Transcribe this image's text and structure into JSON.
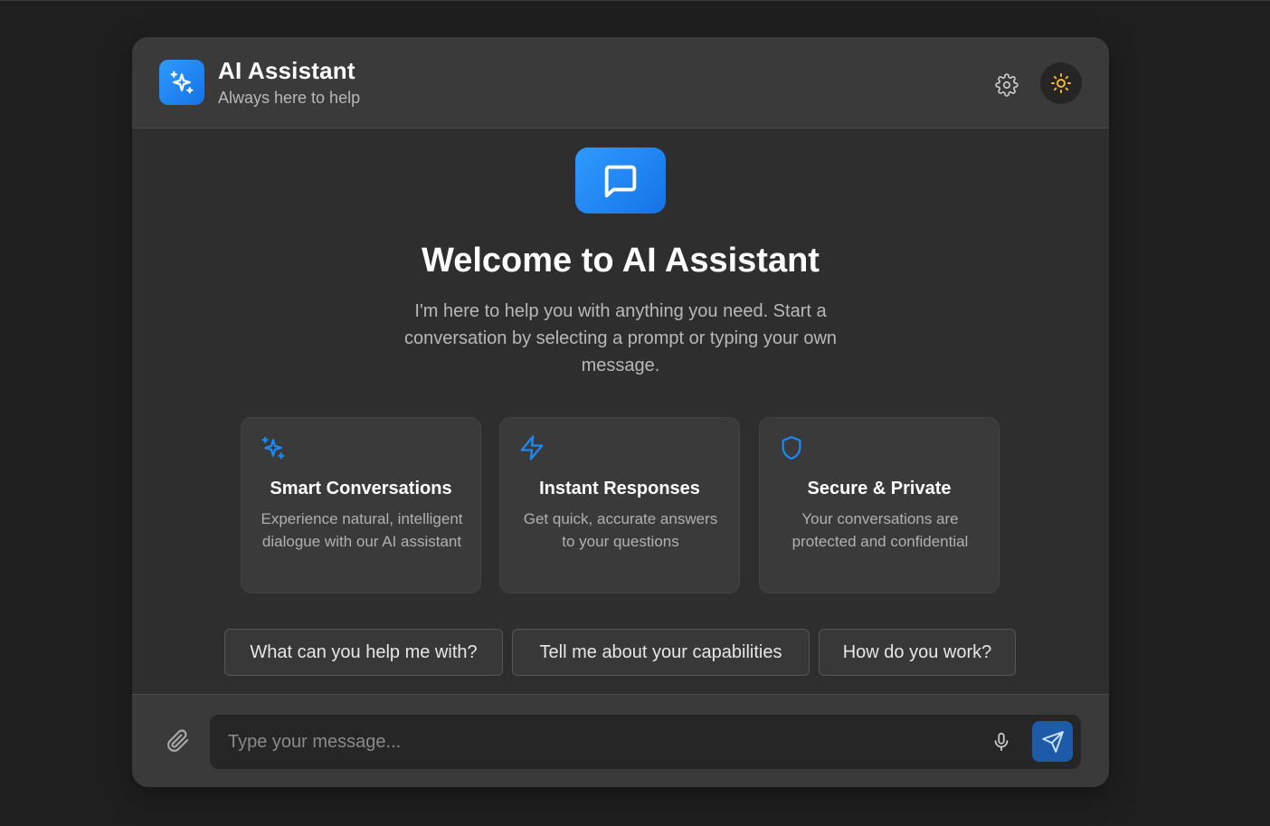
{
  "header": {
    "title": "AI Assistant",
    "subtitle": "Always here to help",
    "logo_icon": "sparkles-icon",
    "settings_icon": "gear-icon",
    "theme_icon": "sun-icon"
  },
  "welcome": {
    "icon": "chat-bubble-icon",
    "title": "Welcome to AI Assistant",
    "description": "I'm here to help you with anything you need. Start a conversation by selecting a prompt or typing your own message."
  },
  "features": [
    {
      "icon": "sparkles-icon",
      "title": "Smart Conversations",
      "description": "Experience natural, intelligent dialogue with our AI assistant"
    },
    {
      "icon": "lightning-icon",
      "title": "Instant Responses",
      "description": "Get quick, accurate answers to your questions"
    },
    {
      "icon": "shield-icon",
      "title": "Secure & Private",
      "description": "Your conversations are protected and confidential"
    }
  ],
  "prompts": [
    "What can you help me with?",
    "Tell me about your capabilities",
    "How do you work?"
  ],
  "composer": {
    "placeholder": "Type your message...",
    "attach_icon": "paperclip-icon",
    "mic_icon": "microphone-icon",
    "send_icon": "send-icon"
  },
  "colors": {
    "accent": "#1e88f5",
    "theme_icon": "#f5b82e",
    "background": "#1f1f1f",
    "panel": "#2e2e2e"
  }
}
